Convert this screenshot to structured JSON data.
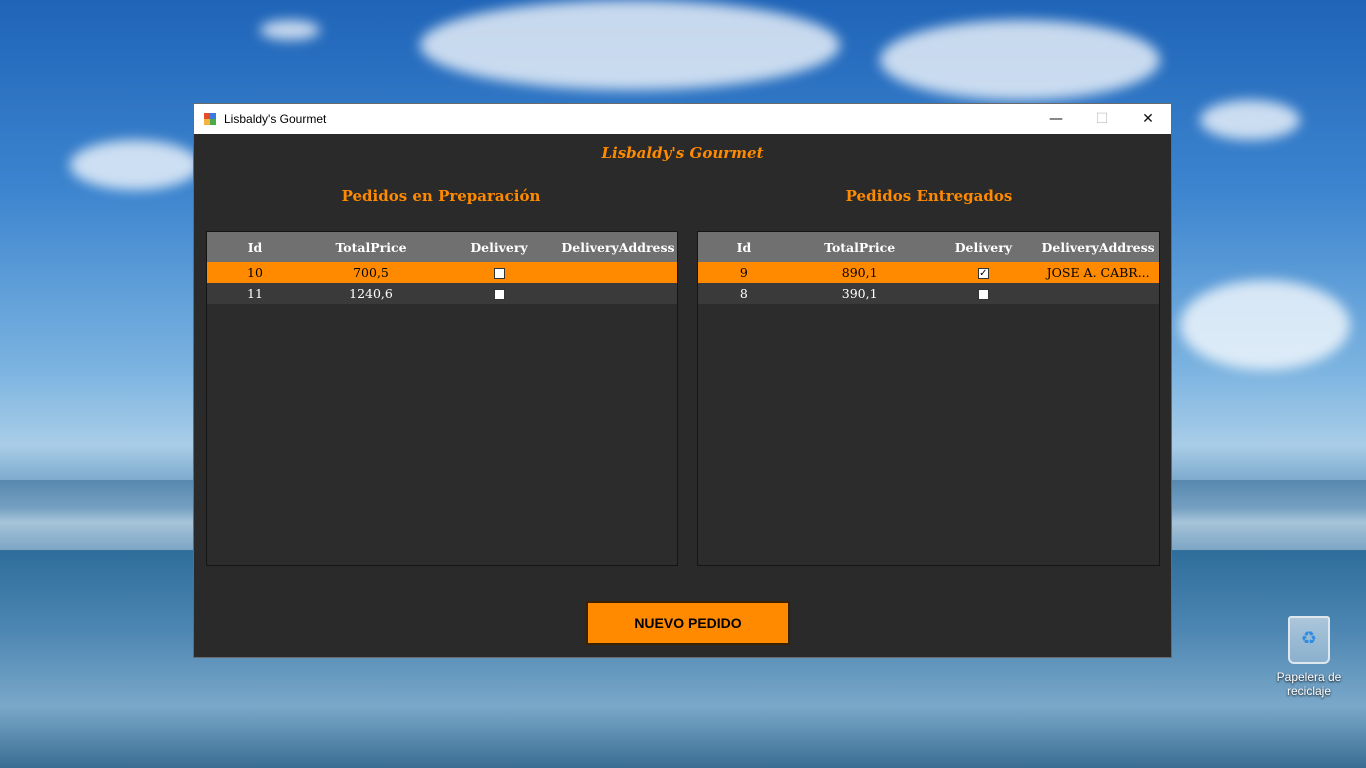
{
  "window": {
    "title": "Lisbaldy's Gourmet",
    "controls": {
      "minimize": "—",
      "maximize": "☐",
      "close": "✕"
    }
  },
  "app": {
    "title": "Lisbaldy's Gourmet",
    "accent_color": "#ff8a00"
  },
  "preparing": {
    "title": "Pedidos en Preparación",
    "columns": [
      "Id",
      "TotalPrice",
      "Delivery",
      "DeliveryAddress"
    ],
    "rows": [
      {
        "id": "10",
        "total": "700,5",
        "delivery": false,
        "address": "",
        "selected": true
      },
      {
        "id": "11",
        "total": "1240,6",
        "delivery": false,
        "address": "",
        "selected": false
      }
    ]
  },
  "delivered": {
    "title": "Pedidos Entregados",
    "columns": [
      "Id",
      "TotalPrice",
      "Delivery",
      "DeliveryAddress"
    ],
    "rows": [
      {
        "id": "9",
        "total": "890,1",
        "delivery": true,
        "address": "JOSE A. CABR...",
        "selected": true
      },
      {
        "id": "8",
        "total": "390,1",
        "delivery": false,
        "address": "",
        "selected": false
      }
    ]
  },
  "actions": {
    "new_order": "NUEVO PEDIDO"
  },
  "desktop": {
    "recycle_bin": "Papelera de reciclaje"
  }
}
